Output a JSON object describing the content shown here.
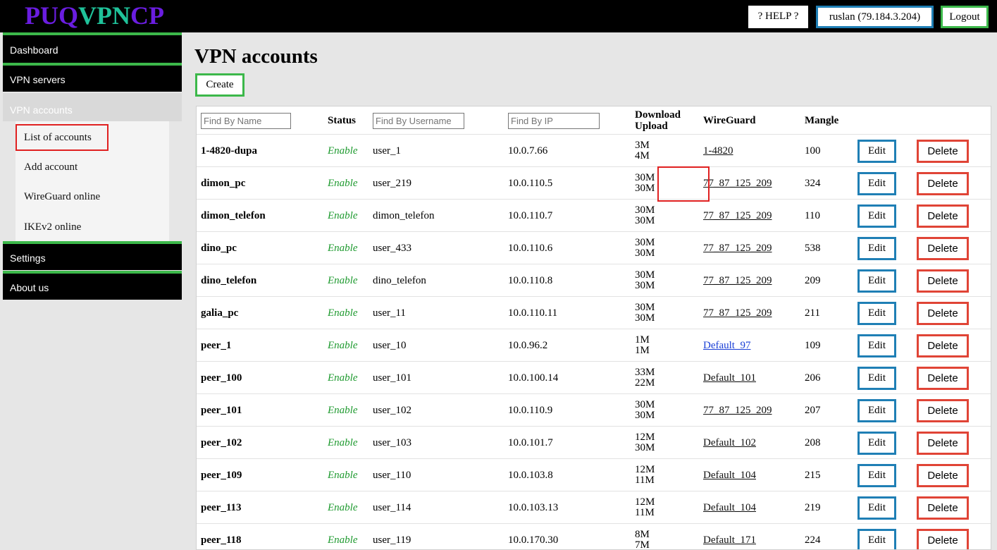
{
  "logo": {
    "part1": "PUQ",
    "part2": "VPN",
    "part3": "CP"
  },
  "header": {
    "help_label": "? HELP ?",
    "user_label": "ruslan (79.184.3.204)",
    "logout_label": "Logout"
  },
  "sidebar": {
    "items": [
      {
        "label": "Dashboard"
      },
      {
        "label": "VPN servers"
      },
      {
        "label": "VPN accounts"
      },
      {
        "label": "Settings"
      },
      {
        "label": "About us"
      }
    ],
    "submenu": [
      {
        "label": "List of accounts"
      },
      {
        "label": "Add account"
      },
      {
        "label": "WireGuard online"
      },
      {
        "label": "IKEv2 online"
      }
    ]
  },
  "main": {
    "title": "VPN accounts",
    "create_label": "Create"
  },
  "table": {
    "filters": {
      "name_placeholder": "Find By Name",
      "username_placeholder": "Find By Username",
      "ip_placeholder": "Find By IP"
    },
    "headers": {
      "status": "Status",
      "download": "Download",
      "upload": "Upload",
      "wireguard": "WireGuard",
      "mangle": "Mangle"
    },
    "edit_label": "Edit",
    "delete_label": "Delete",
    "rows": [
      {
        "name": "1-4820-dupa",
        "status": "Enable",
        "username": "user_1",
        "ip": "10.0.7.66",
        "download": "3M",
        "upload": "4M",
        "wireguard": "1-4820",
        "mangle": "100"
      },
      {
        "name": "dimon_pc",
        "status": "Enable",
        "username": "user_219",
        "ip": "10.0.110.5",
        "download": "30M",
        "upload": "30M",
        "wireguard": "77_87_125_209",
        "mangle": "324"
      },
      {
        "name": "dimon_telefon",
        "status": "Enable",
        "username": "dimon_telefon",
        "ip": "10.0.110.7",
        "download": "30M",
        "upload": "30M",
        "wireguard": "77_87_125_209",
        "mangle": "110"
      },
      {
        "name": "dino_pc",
        "status": "Enable",
        "username": "user_433",
        "ip": "10.0.110.6",
        "download": "30M",
        "upload": "30M",
        "wireguard": "77_87_125_209",
        "mangle": "538"
      },
      {
        "name": "dino_telefon",
        "status": "Enable",
        "username": "dino_telefon",
        "ip": "10.0.110.8",
        "download": "30M",
        "upload": "30M",
        "wireguard": "77_87_125_209",
        "mangle": "209"
      },
      {
        "name": "galia_pc",
        "status": "Enable",
        "username": "user_11",
        "ip": "10.0.110.11",
        "download": "30M",
        "upload": "30M",
        "wireguard": "77_87_125_209",
        "mangle": "211"
      },
      {
        "name": "peer_1",
        "status": "Enable",
        "username": "user_10",
        "ip": "10.0.96.2",
        "download": "1M",
        "upload": "1M",
        "wireguard": "Default_97",
        "mangle": "109"
      },
      {
        "name": "peer_100",
        "status": "Enable",
        "username": "user_101",
        "ip": "10.0.100.14",
        "download": "33M",
        "upload": "22M",
        "wireguard": "Default_101",
        "mangle": "206"
      },
      {
        "name": "peer_101",
        "status": "Enable",
        "username": "user_102",
        "ip": "10.0.110.9",
        "download": "30M",
        "upload": "30M",
        "wireguard": "77_87_125_209",
        "mangle": "207"
      },
      {
        "name": "peer_102",
        "status": "Enable",
        "username": "user_103",
        "ip": "10.0.101.7",
        "download": "12M",
        "upload": "30M",
        "wireguard": "Default_102",
        "mangle": "208"
      },
      {
        "name": "peer_109",
        "status": "Enable",
        "username": "user_110",
        "ip": "10.0.103.8",
        "download": "12M",
        "upload": "11M",
        "wireguard": "Default_104",
        "mangle": "215"
      },
      {
        "name": "peer_113",
        "status": "Enable",
        "username": "user_114",
        "ip": "10.0.103.13",
        "download": "12M",
        "upload": "11M",
        "wireguard": "Default_104",
        "mangle": "219"
      },
      {
        "name": "peer_118",
        "status": "Enable",
        "username": "user_119",
        "ip": "10.0.170.30",
        "download": "8M",
        "upload": "7M",
        "wireguard": "Default_171",
        "mangle": "224"
      }
    ]
  }
}
